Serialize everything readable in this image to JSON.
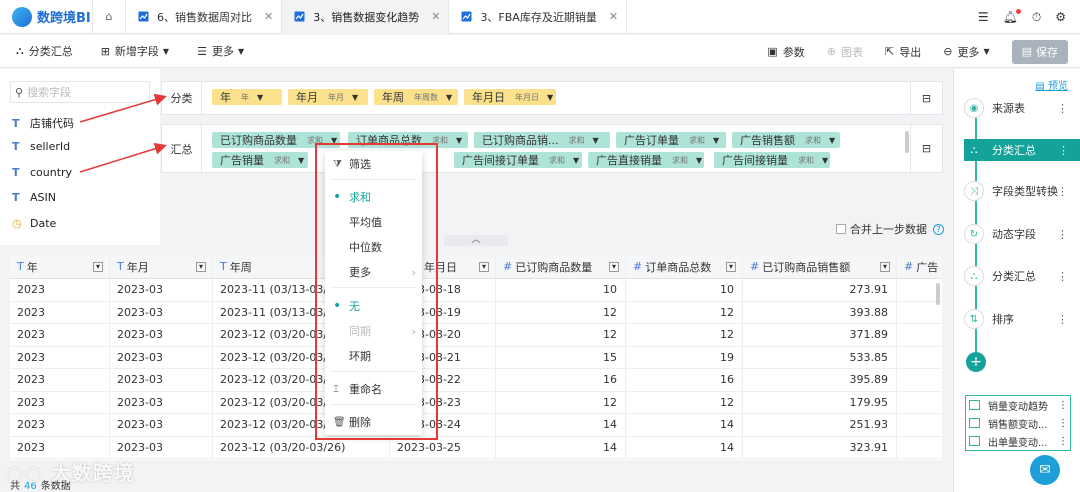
{
  "app": {
    "logo_text": "数跨境BI"
  },
  "tabs": [
    {
      "label": "6、销售数据周对比"
    },
    {
      "label": "3、销售数据变化趋势"
    },
    {
      "label": "3、FBA库存及近期销量"
    }
  ],
  "toolbar": {
    "group_summary": "分类汇总",
    "add_field": "新增字段",
    "more": "更多",
    "params": "参数",
    "chart": "图表",
    "export": "导出",
    "more_right": "更多",
    "save": "保存"
  },
  "fields": {
    "search_placeholder": "搜索字段",
    "items": [
      {
        "type": "T",
        "name": "店铺代码"
      },
      {
        "type": "T",
        "name": "sellerId"
      },
      {
        "type": "T",
        "name": "country"
      },
      {
        "type": "T",
        "name": "ASIN"
      },
      {
        "type": "date",
        "name": "Date"
      }
    ]
  },
  "group_zone": {
    "label": "分类",
    "chips": [
      {
        "label": "年",
        "sub": "年"
      },
      {
        "label": "年月",
        "sub": "年月"
      },
      {
        "label": "年周",
        "sub": "年周数"
      },
      {
        "label": "年月日",
        "sub": "年月日"
      }
    ]
  },
  "agg_zone": {
    "label": "汇总",
    "chips": [
      {
        "label": "已订购商品数量",
        "sub": "求和"
      },
      {
        "label": "订单商品总数",
        "sub": "求和"
      },
      {
        "label": "已订购商品销...",
        "sub": "求和"
      },
      {
        "label": "广告订单量",
        "sub": "求和"
      },
      {
        "label": "广告销售额",
        "sub": "求和"
      },
      {
        "label": "广告销量",
        "sub": "求和"
      },
      {
        "label": "广告间接订单量",
        "sub": "求和"
      },
      {
        "label": "广告直接销量",
        "sub": "求和"
      },
      {
        "label": "广告间接销量",
        "sub": "求和"
      }
    ]
  },
  "merge_label": "合并上一步数据",
  "table": {
    "headers": [
      "年",
      "年月",
      "年周",
      "年月日",
      "已订购商品数量",
      "订单商品总数",
      "已订购商品销售额",
      "广告"
    ],
    "rows": [
      [
        "2023",
        "2023-03",
        "2023-11 (03/13-03/19)",
        "2023-03-18",
        "10",
        "10",
        "273.91"
      ],
      [
        "2023",
        "2023-03",
        "2023-11 (03/13-03/19)",
        "2023-03-19",
        "12",
        "12",
        "393.88"
      ],
      [
        "2023",
        "2023-03",
        "2023-12 (03/20-03/26)",
        "2023-03-20",
        "12",
        "12",
        "371.89"
      ],
      [
        "2023",
        "2023-03",
        "2023-12 (03/20-03/26)",
        "2023-03-21",
        "15",
        "19",
        "533.85"
      ],
      [
        "2023",
        "2023-03",
        "2023-12 (03/20-03/26)",
        "2023-03-22",
        "16",
        "16",
        "395.89"
      ],
      [
        "2023",
        "2023-03",
        "2023-12 (03/20-03/26)",
        "2023-03-23",
        "12",
        "12",
        "179.95"
      ],
      [
        "2023",
        "2023-03",
        "2023-12 (03/20-03/26)",
        "2023-03-24",
        "14",
        "14",
        "251.93"
      ],
      [
        "2023",
        "2023-03",
        "2023-12 (03/20-03/26)",
        "2023-03-25",
        "14",
        "14",
        "323.91"
      ]
    ]
  },
  "footer": {
    "prefix": "共",
    "count": "46",
    "suffix": "条数据"
  },
  "flow": {
    "preview": "预览",
    "nodes": [
      {
        "label": "来源表",
        "icon": "source-icon"
      },
      {
        "label": "分类汇总",
        "icon": "group-icon",
        "active": true
      },
      {
        "label": "字段类型转换",
        "icon": "convert-icon"
      },
      {
        "label": "动态字段",
        "icon": "dynamic-icon"
      },
      {
        "label": "分类汇总",
        "icon": "group-icon"
      },
      {
        "label": "排序",
        "icon": "sort-icon"
      }
    ],
    "outputs": [
      "销量变动趋势",
      "销售额变动...",
      "出单量变动..."
    ]
  },
  "context_menu": {
    "filter": "筛选",
    "sum": "求和",
    "avg": "平均值",
    "median": "中位数",
    "more": "更多",
    "none": "无",
    "yoy": "同期",
    "mom": "环期",
    "rename": "重命名",
    "delete": "删除"
  },
  "watermark": "大数跨境",
  "colors": {
    "accent": "#14a39a",
    "group_chip": "#fbe18c",
    "agg_chip": "#aee3d8",
    "annotation": "#e53935"
  }
}
